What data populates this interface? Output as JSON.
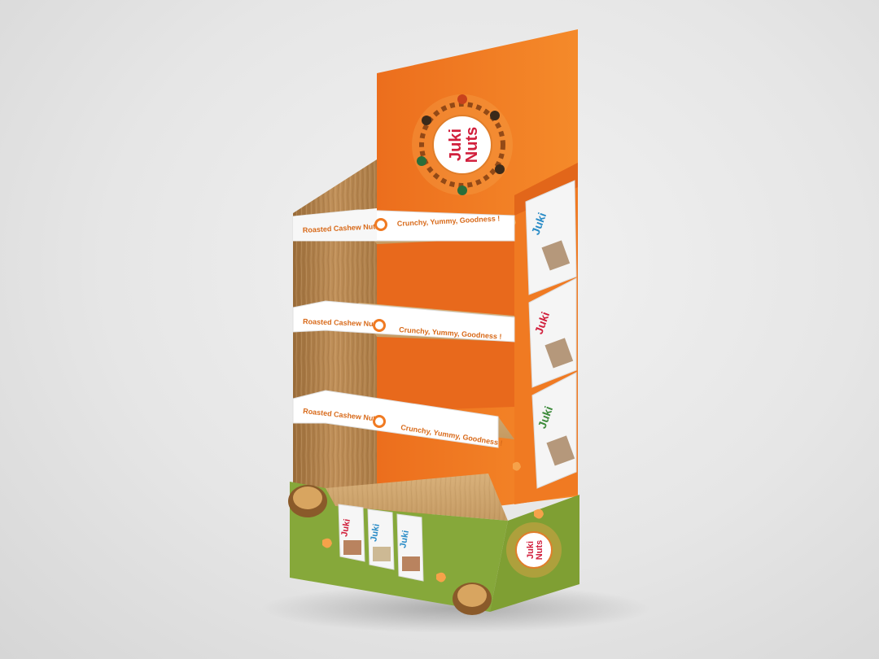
{
  "brand": {
    "line1": "Juki",
    "line2": "Nuts"
  },
  "shelves": [
    {
      "product": "Roasted Cashew Nuts",
      "tagline": "Crunchy, Yummy, Goodness !"
    },
    {
      "product": "Roasted Cashew Nuts",
      "tagline": "Crunchy, Yummy, Goodness !"
    },
    {
      "product": "Roasted Cashew Nuts",
      "tagline": "Crunchy, Yummy, Goodness !"
    }
  ],
  "colors": {
    "orange": "#f07a22",
    "green": "#86a83a",
    "wood": "#b8894f",
    "brand_red": "#d11f3c",
    "brand_blue": "#2a8cc7"
  }
}
